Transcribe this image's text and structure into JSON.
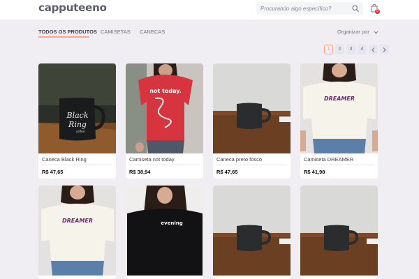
{
  "header": {
    "logo": "capputeeno",
    "search_placeholder": "Procurando algo específico?",
    "search_icon": "search-icon",
    "cart_icon": "shopping-bag-icon",
    "cart_badge": "0"
  },
  "tabs": {
    "items": [
      {
        "label": "Todos os produtos",
        "active": true
      },
      {
        "label": "Camisetas",
        "active": false
      },
      {
        "label": "Canecas",
        "active": false
      }
    ]
  },
  "sort": {
    "label": "Organizar por",
    "icon": "chevron-down-icon"
  },
  "pagination": {
    "pages": [
      "1",
      "2",
      "3",
      "4"
    ],
    "active_page": "1",
    "prev_icon": "chevron-left-icon",
    "next_icon": "chevron-right-icon"
  },
  "products": [
    {
      "name": "Caneca Black Ring",
      "price": "R$ 47,65",
      "image": "black-ring-mug"
    },
    {
      "name": "Camiseta not today.",
      "price": "R$ 38,94",
      "image": "not-today-tshirt"
    },
    {
      "name": "Caneca preto fosco",
      "price": "R$ 47,65",
      "image": "matte-black-mug"
    },
    {
      "name": "Camiseta DREAMER",
      "price": "R$ 41,98",
      "image": "dreamer-tshirt"
    },
    {
      "name": "",
      "price": "",
      "image": "dreamer-tshirt"
    },
    {
      "name": "",
      "price": "",
      "image": "evening-tshirt"
    },
    {
      "name": "",
      "price": "",
      "image": "matte-black-mug"
    },
    {
      "name": "",
      "price": "",
      "image": "matte-black-mug"
    }
  ],
  "image_text": {
    "black_ring_line1": "Black",
    "black_ring_line2": "Ring",
    "black_ring_line3": "coffee",
    "not_today": "not today.",
    "dreamer": "DREAMER",
    "evening": "evening"
  },
  "colors": {
    "accent": "#ffa585",
    "background": "#f0eef3",
    "badge": "#de3838"
  }
}
